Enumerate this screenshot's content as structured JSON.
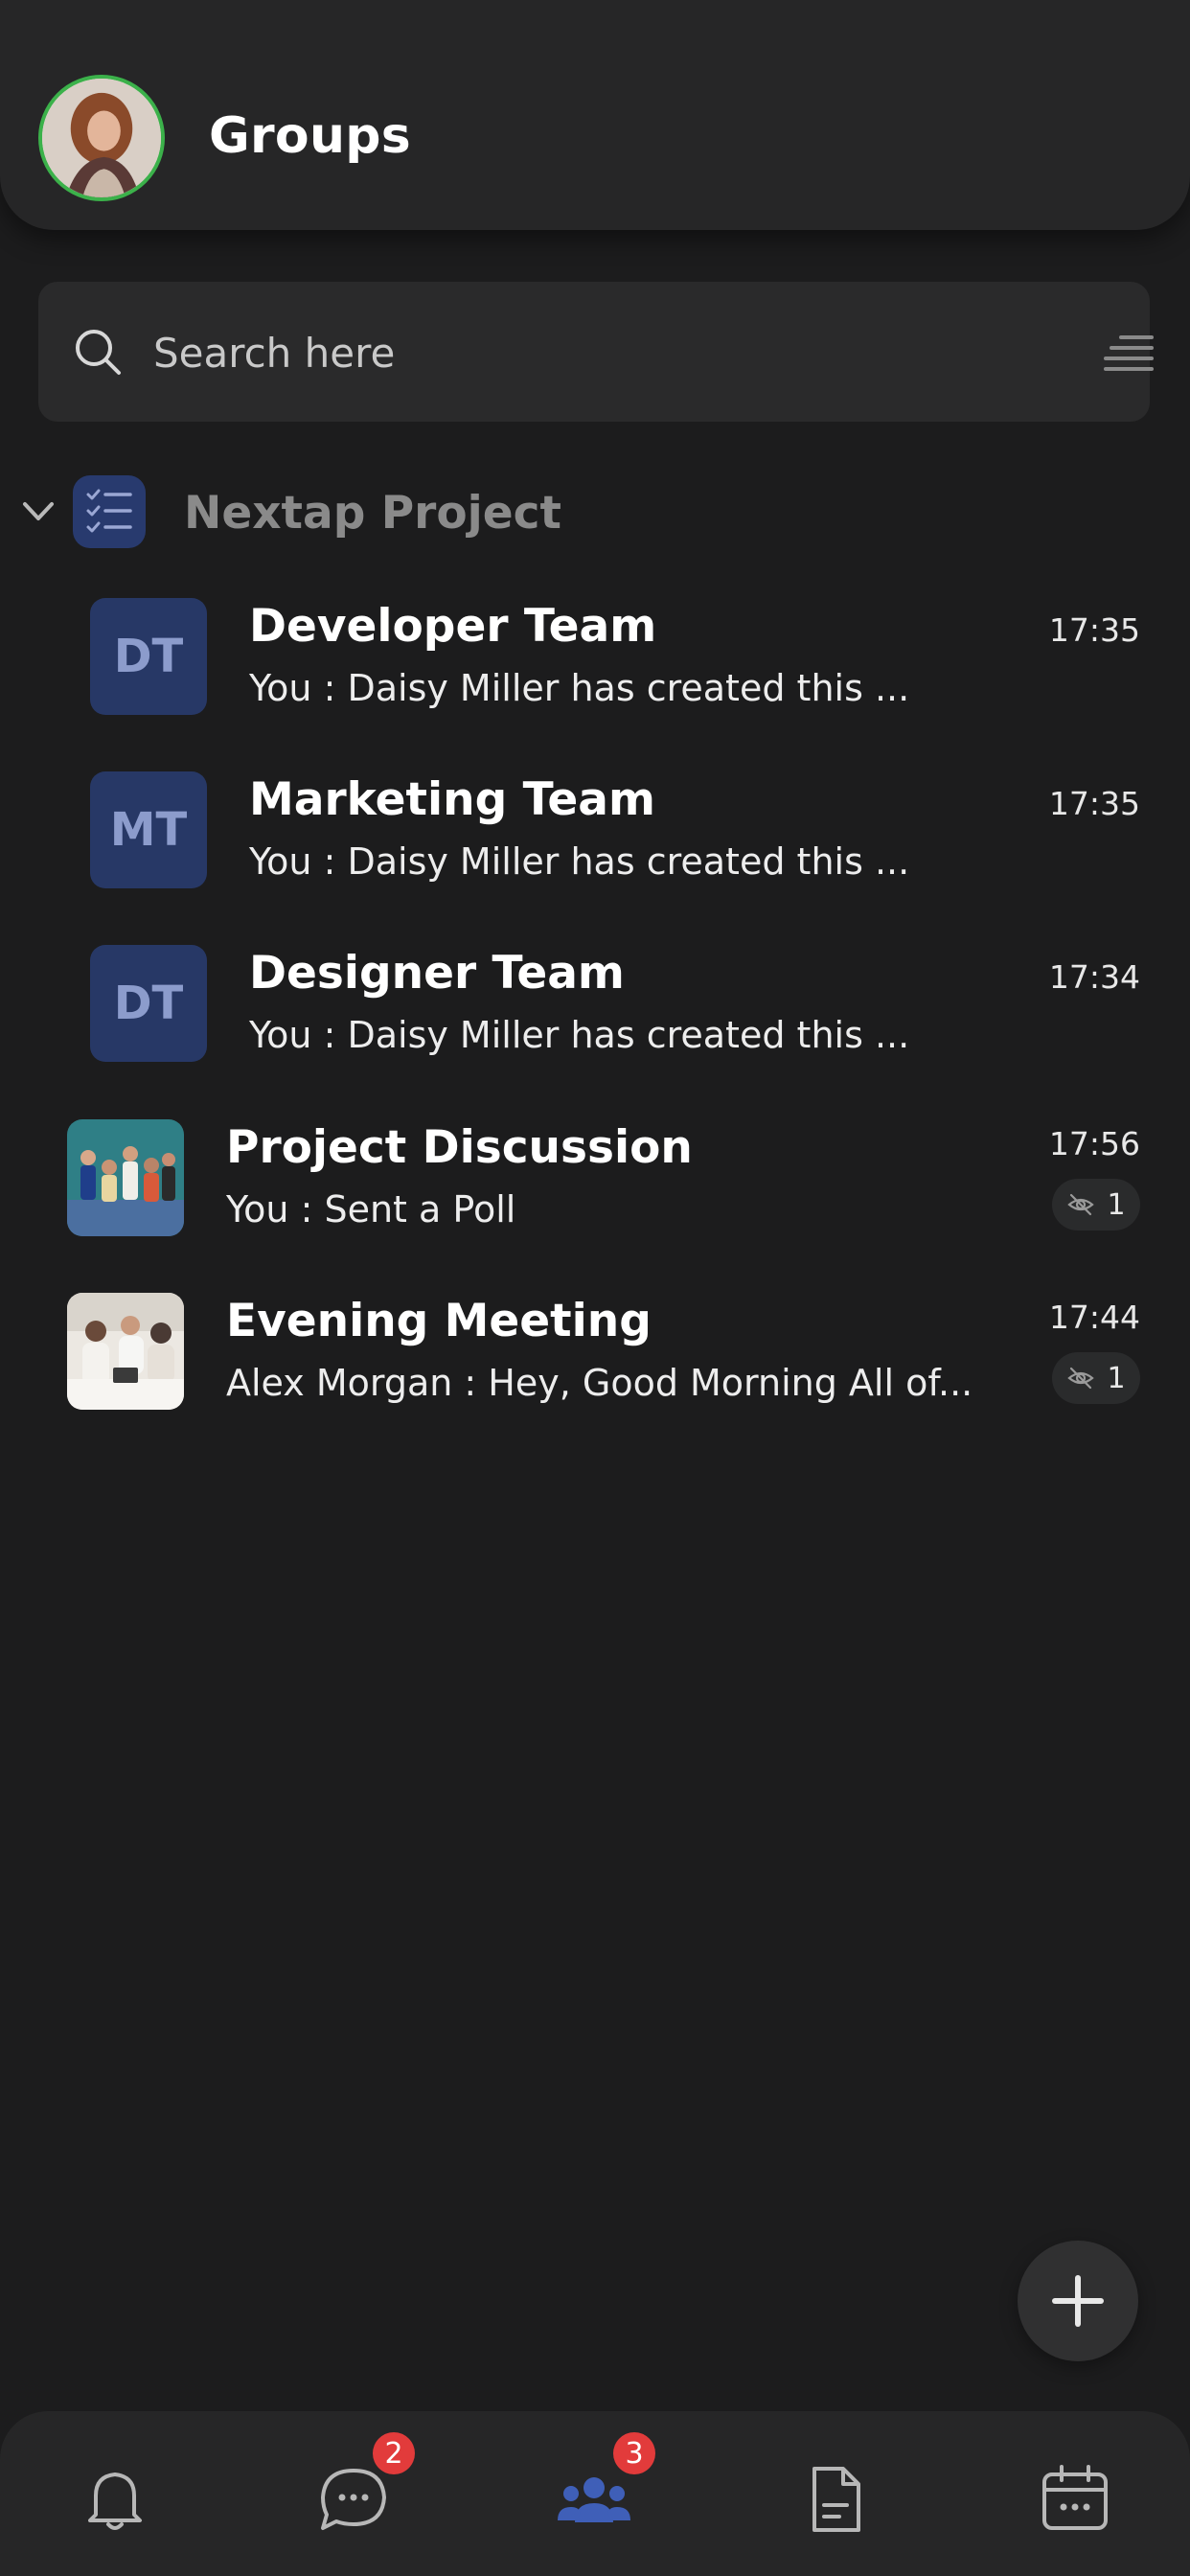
{
  "header": {
    "title": "Groups",
    "avatar_icon": "user-avatar-photo",
    "avatar_ring_color": "#3bb14a"
  },
  "search": {
    "placeholder": "Search here",
    "icon": "search-icon",
    "filter_icon": "filter-lines-icon"
  },
  "folder": {
    "name": "Nextap Project",
    "icon": "checklist-icon",
    "expanded": true
  },
  "groups": [
    {
      "name": "Developer Team",
      "initials": "DT",
      "last_message": "You : Daisy Miller has created this ...",
      "time": "17:35"
    },
    {
      "name": "Marketing Team",
      "initials": "MT",
      "last_message": "You : Daisy Miller has created this ...",
      "time": "17:35"
    },
    {
      "name": "Designer Team",
      "initials": "DT",
      "last_message": "You : Daisy Miller has created this ...",
      "time": "17:34"
    },
    {
      "name": "Project Discussion",
      "last_message": "You : Sent a Poll",
      "time": "17:56",
      "muted": true,
      "unread": "1"
    },
    {
      "name": "Evening Meeting",
      "last_message": "Alex Morgan : Hey, Good Morning All of...",
      "time": "17:44",
      "muted": true,
      "unread": "1"
    }
  ],
  "fab": {
    "icon": "plus-icon"
  },
  "bottom_nav": [
    {
      "id": "notifications",
      "icon": "bell-icon"
    },
    {
      "id": "chats",
      "icon": "chat-bubble-icon",
      "badge": "2"
    },
    {
      "id": "groups",
      "icon": "group-people-icon",
      "badge": "3",
      "active": true
    },
    {
      "id": "files",
      "icon": "document-icon"
    },
    {
      "id": "calendar",
      "icon": "calendar-icon"
    }
  ],
  "colors": {
    "background": "#1c1c1d",
    "surface": "#262627",
    "tile": "#273866",
    "accent": "#3f5fb8",
    "badge": "#e23b3b"
  }
}
